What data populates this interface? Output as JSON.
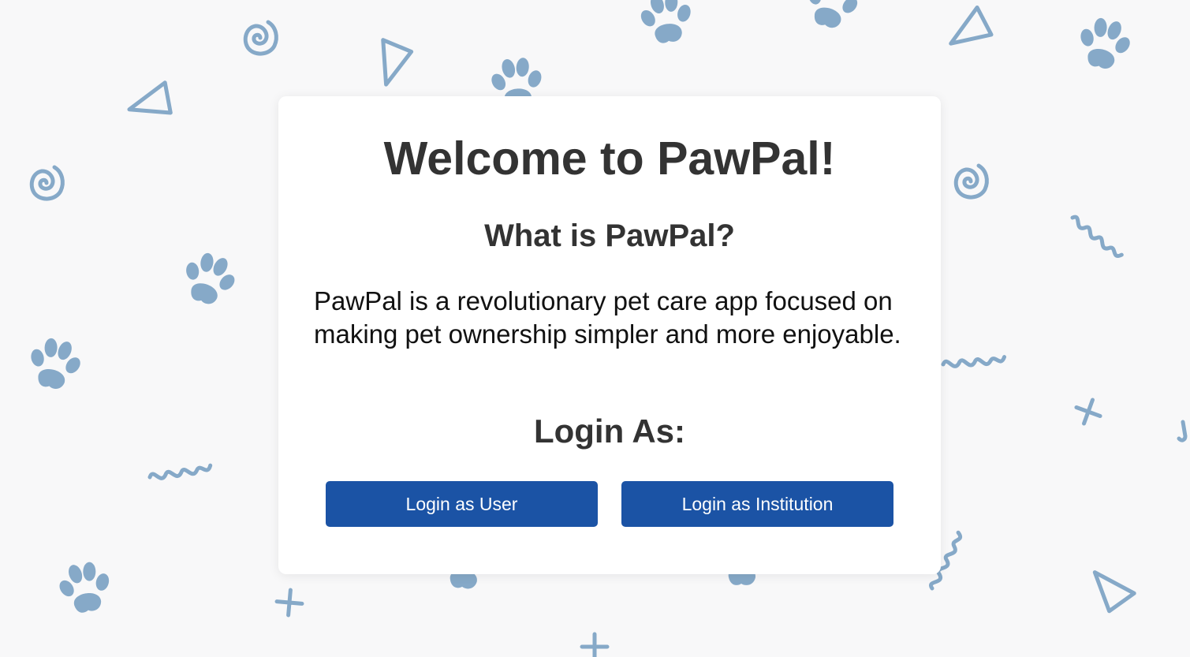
{
  "background": {
    "pattern_color": "#86a9c8",
    "page_color": "#f8f8f9",
    "icons": [
      "paw-icon",
      "triangle-icon",
      "spiral-icon",
      "squiggle-icon",
      "cross-icon"
    ]
  },
  "welcome": {
    "title": "Welcome to PawPal!",
    "subtitle": "What is PawPal?",
    "description": "PawPal is a revolutionary pet care app focused on making pet ownership simpler and more enjoyable.",
    "login_heading": "Login As:"
  },
  "buttons": {
    "user_label": "Login as User",
    "institution_label": "Login as Institution",
    "color": "#1b53a5"
  }
}
